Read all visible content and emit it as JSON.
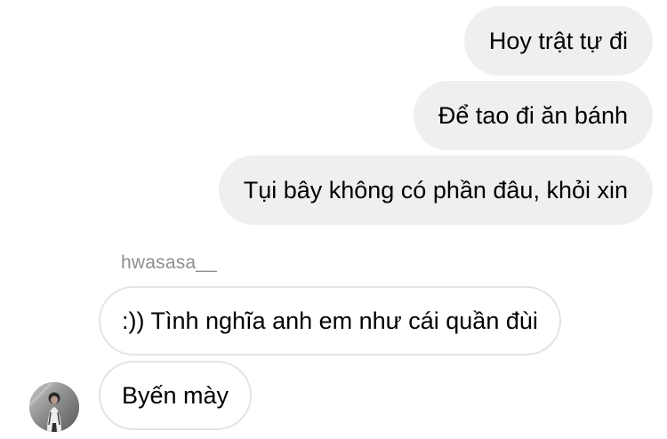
{
  "conversation": {
    "outgoing": [
      {
        "text": "Hoy trật tự đi"
      },
      {
        "text": "Để tao đi ăn bánh"
      },
      {
        "text": "Tụi bây không có phần đâu, khỏi xin"
      }
    ],
    "incoming": {
      "sender": "hwasasa__",
      "messages": [
        {
          "text": ":)) Tình nghĩa anh em như cái quần đùi"
        },
        {
          "text": "Byến mày"
        }
      ]
    }
  },
  "colors": {
    "outgoing_bubble": "#efefef",
    "incoming_border": "#e3e3e3",
    "sender_text": "#8e8e8e"
  },
  "icons": {
    "avatar": "profile-photo"
  }
}
